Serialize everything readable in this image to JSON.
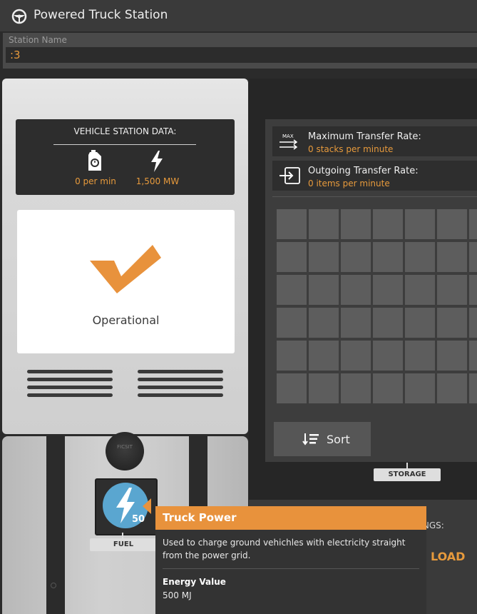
{
  "window": {
    "title": "Powered Truck Station",
    "icon": "steering-wheel-icon"
  },
  "station_name": {
    "label": "Station Name",
    "value": ":3"
  },
  "vehicle_station_data": {
    "heading": "VEHICLE STATION DATA:",
    "fuel_rate": "0 per min",
    "power": "1,500 MW"
  },
  "status": {
    "text": "Operational"
  },
  "fuel_slot": {
    "label": "FUEL",
    "count": "50"
  },
  "cap_brand": "FICSIT",
  "transfer": {
    "max_label": "Maximum Transfer Rate:",
    "max_value": "0 stacks per minute",
    "max_icon_text": "MAX",
    "out_label": "Outgoing Transfer Rate:",
    "out_value": "0 items per minute"
  },
  "storage": {
    "sort_label": "Sort",
    "label": "STORAGE",
    "rows": 6,
    "cols_visible": 7
  },
  "bottom": {
    "settings_fragment": "TINGS:",
    "load_fragment": "LOAD"
  },
  "tooltip": {
    "title": "Truck Power",
    "description": "Used to charge ground vehichles with electricity straight from the power grid.",
    "energy_label": "Energy Value",
    "energy_value": "500 MJ"
  },
  "colors": {
    "accent": "#e8923c",
    "value_text": "#e79a3c",
    "check": "#e8923c"
  }
}
